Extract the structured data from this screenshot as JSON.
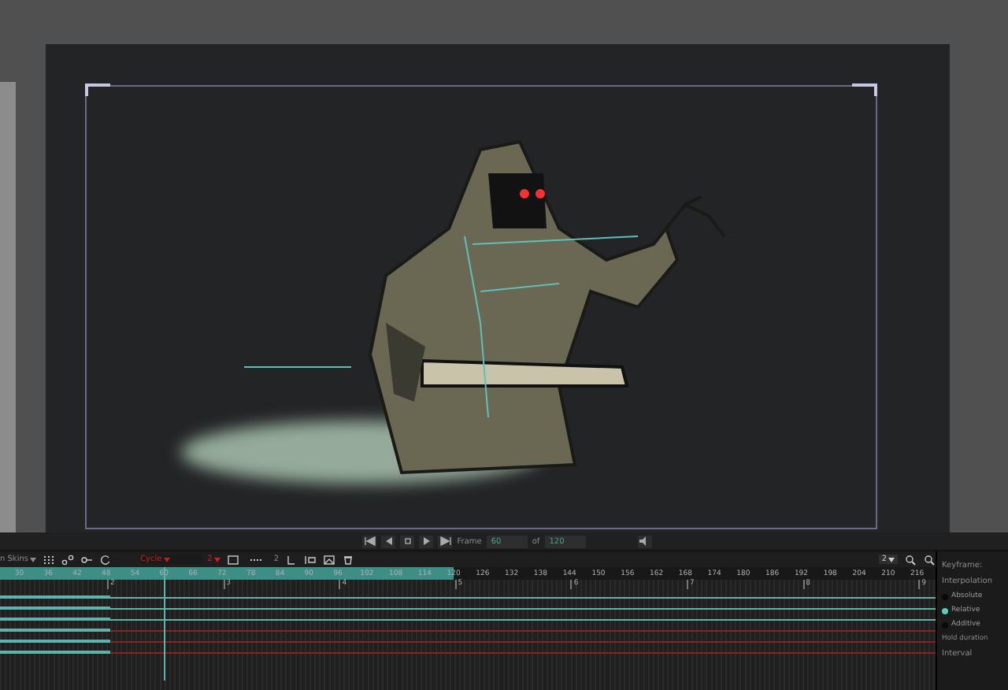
{
  "playback": {
    "frame_label": "Frame",
    "frame_value": "60",
    "of_label": "of",
    "total_value": "120"
  },
  "toolbar": {
    "skins_label": "n Skins",
    "mode": "Cycle",
    "mode_count": "2",
    "step_count": "2",
    "zoom_value": "2"
  },
  "ruler": {
    "ticks": [
      "30",
      "36",
      "42",
      "48",
      "54",
      "60",
      "66",
      "72",
      "78",
      "84",
      "90",
      "96",
      "102",
      "108",
      "114",
      "120",
      "126",
      "132",
      "138",
      "144",
      "150",
      "156",
      "162",
      "168",
      "174",
      "180",
      "186",
      "192",
      "198",
      "204",
      "210",
      "216"
    ]
  },
  "sections": [
    "2",
    "3",
    "4",
    "5",
    "6",
    "7",
    "8",
    "9"
  ],
  "lanes": [
    {
      "color": "#5fb3a8"
    },
    {
      "color": "#5fb3a8"
    },
    {
      "color": "#5fb3a8"
    },
    {
      "color": "#8a2222"
    },
    {
      "color": "#8a2222"
    },
    {
      "color": "#8a2222"
    }
  ],
  "side_panel": {
    "keyframe_label": "Keyframe:",
    "interpolation_label": "Interpolation",
    "options": [
      {
        "label": "Absolute",
        "selected": false
      },
      {
        "label": "Relative",
        "selected": true
      },
      {
        "label": "Additive",
        "selected": false
      }
    ],
    "hold_label": "Hold duration",
    "interval_label": "Interval"
  }
}
